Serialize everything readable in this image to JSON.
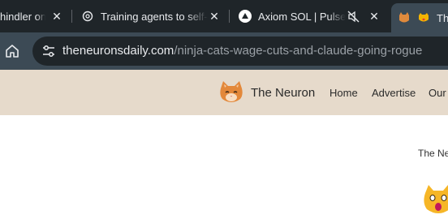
{
  "tabs": [
    {
      "title": "hindler on",
      "icon": "site-icon",
      "active": false
    },
    {
      "title": "Training agents to self-r",
      "icon": "openai-icon",
      "active": false
    },
    {
      "title": "Axiom SOL | Pulse",
      "icon": "axiom-icon",
      "active": false,
      "muted": true
    },
    {
      "title": "The",
      "icon": "neuron-cat-icon",
      "active": true
    }
  ],
  "toolbar": {
    "url_domain": "theneuronsdaily.com",
    "url_path": "/ninja-cats-wage-cuts-and-claude-going-rogue"
  },
  "site": {
    "brand": "The Neuron",
    "nav": [
      "Home",
      "Advertise",
      "Our"
    ],
    "byline": "The Ne"
  },
  "colors": {
    "tabstrip_bg": "#1f2529",
    "toolbar_bg": "#3c4a55",
    "header_bg": "#e6dacb"
  }
}
